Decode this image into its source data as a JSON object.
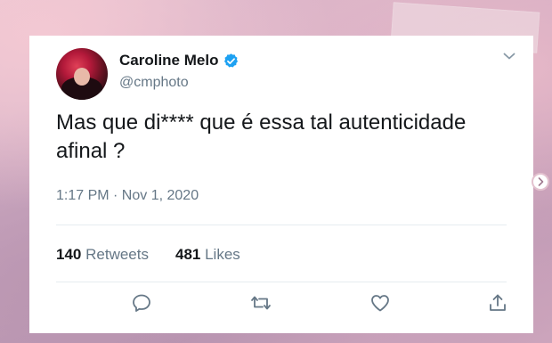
{
  "tweet": {
    "author_name": "Caroline Melo",
    "author_handle": "@cmphoto",
    "text": "Mas que di**** que é essa tal autenticidade afinal ?",
    "timestamp": "1:17 PM · Nov 1, 2020",
    "retweets": {
      "count": "140",
      "label": "Retweets"
    },
    "likes": {
      "count": "481",
      "label": "Likes"
    }
  },
  "icons": {
    "verified": "verified-badge-icon",
    "menu": "chevron-down-icon",
    "reply": "reply-icon",
    "retweet": "retweet-icon",
    "like": "heart-icon",
    "share": "share-icon",
    "next": "chevron-right-icon"
  },
  "colors": {
    "verified": "#1da1f2",
    "text_primary": "#14171a",
    "text_secondary": "#657786",
    "divider": "#e6ecf0"
  }
}
